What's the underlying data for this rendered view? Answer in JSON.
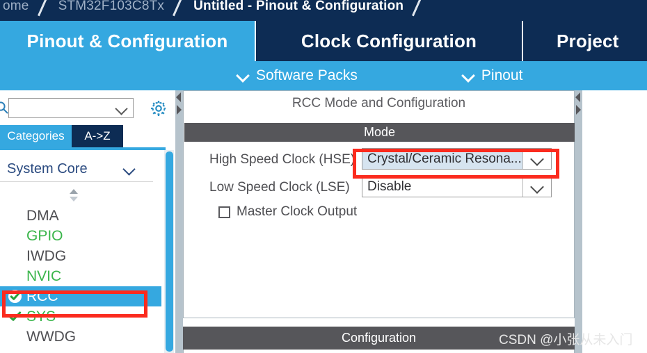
{
  "breadcrumb": {
    "items": [
      {
        "label": "ome",
        "style": "dim"
      },
      {
        "label": "STM32F103C8Tx",
        "style": "dim"
      },
      {
        "label": "Untitled - Pinout & Configuration",
        "style": "strong"
      }
    ]
  },
  "tabs": [
    {
      "label": "Pinout & Configuration",
      "active": true
    },
    {
      "label": "Clock Configuration",
      "active": false
    },
    {
      "label": "Project",
      "active": false
    }
  ],
  "subnav": {
    "items": [
      {
        "label": "Software Packs",
        "icon": "chevron-down-icon"
      },
      {
        "label": "Pinout",
        "icon": "chevron-down-icon"
      }
    ]
  },
  "sidebar": {
    "search": {
      "value": "",
      "placeholder": "",
      "icon": "search-icon",
      "dropdown_icon": "chevron-down-icon"
    },
    "settings_icon": "gear-icon",
    "segments": [
      {
        "label": "Categories",
        "active": true
      },
      {
        "label": "A->Z",
        "active": false
      }
    ],
    "category": {
      "label": "System Core",
      "expander_icon": "chevron-down-icon",
      "spinner_icon": "sort-spinner-icon"
    },
    "items": [
      {
        "label": "DMA",
        "state": "dark",
        "icon": "none"
      },
      {
        "label": "GPIO",
        "state": "green",
        "icon": "none"
      },
      {
        "label": "IWDG",
        "state": "dark",
        "icon": "none"
      },
      {
        "label": "NVIC",
        "state": "green",
        "icon": "none"
      },
      {
        "label": "RCC",
        "state": "selected",
        "icon": "check-circle-icon"
      },
      {
        "label": "SYS",
        "state": "green",
        "icon": "check-icon"
      },
      {
        "label": "WWDG",
        "state": "dark",
        "icon": "none"
      }
    ]
  },
  "panel": {
    "title": "RCC Mode and Configuration",
    "mode_header": "Mode",
    "configuration_header": "Configuration",
    "rows": [
      {
        "label": "High Speed Clock (HSE)",
        "value": "Crystal/Ceramic Resona...",
        "selected": true,
        "arrow_icon": "chevron-down-icon"
      },
      {
        "label": "Low Speed Clock (LSE)",
        "value": "Disable",
        "selected": false,
        "arrow_icon": "chevron-down-icon"
      }
    ],
    "checkbox": {
      "label": "Master Clock Output",
      "checked": false
    }
  },
  "annotations": {
    "highlight_color": "#fb2b1e",
    "boxes": [
      {
        "target": "hse-combo"
      },
      {
        "target": "sidebar-item-rcc"
      }
    ]
  },
  "watermark": "CSDN @小张从未入门",
  "colors": {
    "navy": "#0d2c54",
    "accent_blue": "#35a8e0",
    "header_gray": "#56565a",
    "green": "#39b54a",
    "selected_field": "#d6e4f0"
  }
}
